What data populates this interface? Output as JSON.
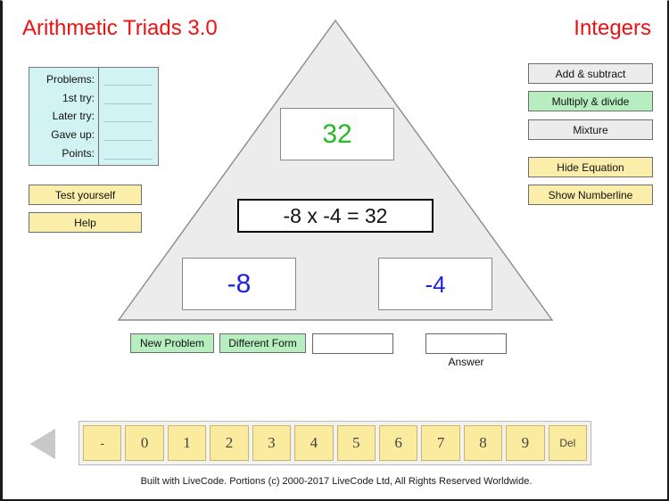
{
  "header": {
    "app_title": "Arithmetic Triads 3.0",
    "mode_title": "Integers"
  },
  "stats": {
    "rows": [
      {
        "label": "Problems:",
        "value": ""
      },
      {
        "label": "1st try:",
        "value": ""
      },
      {
        "label": "Later try:",
        "value": ""
      },
      {
        "label": "Gave up:",
        "value": ""
      },
      {
        "label": "Points:",
        "value": ""
      }
    ]
  },
  "left_buttons": {
    "test_yourself": "Test yourself",
    "help": "Help"
  },
  "right_buttons": {
    "add_subtract": "Add & subtract",
    "multiply_divide": "Multiply & divide",
    "mixture": "Mixture",
    "hide_equation": "Hide Equation",
    "show_numberline": "Show Numberline"
  },
  "triad": {
    "top_value": "32",
    "left_value": "-8",
    "right_value": "-4",
    "equation": "-8 x -4 = 32"
  },
  "controls": {
    "new_problem": "New Problem",
    "different_form": "Different Form",
    "work_input_value": "",
    "answer_input_value": "",
    "answer_label": "Answer"
  },
  "keypad": {
    "keys": [
      "-",
      "0",
      "1",
      "2",
      "3",
      "4",
      "5",
      "6",
      "7",
      "8",
      "9",
      "Del"
    ]
  },
  "footer": {
    "text": "Built with LiveCode. Portions (c) 2000-2017 LiveCode Ltd, All Rights Reserved Worldwide."
  },
  "colors": {
    "title_red": "#ee1111",
    "top_value_green": "#22bb22",
    "operand_blue": "#1a24e0",
    "active_mode_green": "#b6eec0",
    "button_yellow": "#fbeeaa",
    "stats_panel_cyan": "#d2f3f3",
    "triangle_fill": "#ececec"
  }
}
